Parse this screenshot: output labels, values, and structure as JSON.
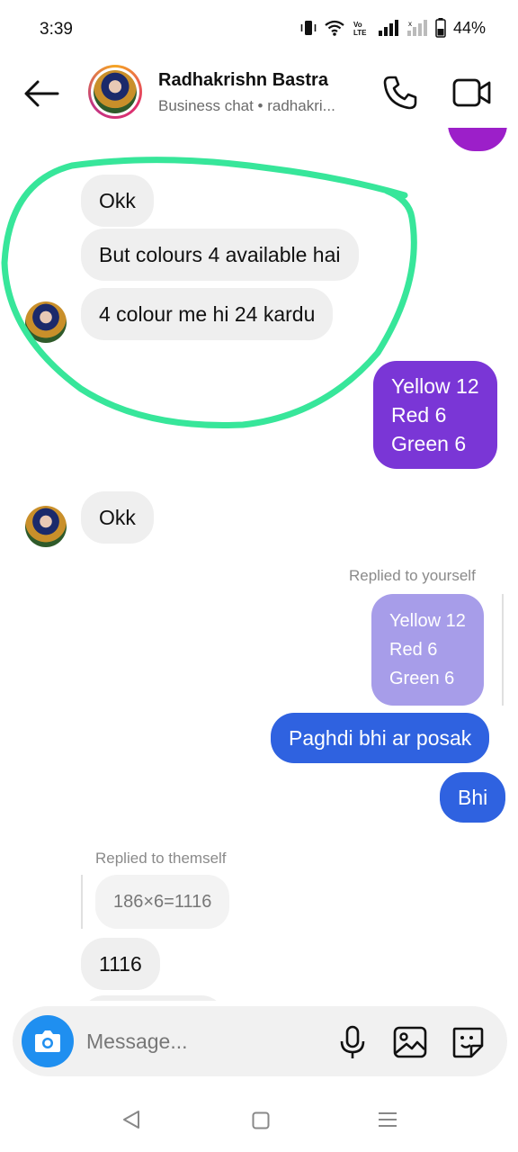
{
  "status_bar": {
    "time": "3:39",
    "battery": "44%"
  },
  "header": {
    "contact_name": "Radhakrishn Bastra",
    "subtitle": "Business chat • radhakri..."
  },
  "messages": {
    "in_1": "Okk",
    "in_2": "But colours 4 available hai",
    "in_3": "4 colour me hi 24 kardu",
    "out_1": "Yellow 12\nRed 6\nGreen 6",
    "in_4": "Okk",
    "reply_label_out": "Replied to yourself",
    "quoted_out": "Yellow 12\nRed 6\nGreen 6",
    "out_2": "Paghdi bhi ar posak",
    "out_3": "Bhi",
    "reply_label_in": "Replied to themself",
    "quoted_in": "186×6=1116",
    "in_5": "1116"
  },
  "composer": {
    "placeholder": "Message..."
  },
  "colors": {
    "outgoing_purple": "#7a36d6",
    "outgoing_blue": "#2f62e0",
    "incoming": "#efefef",
    "highlight_annotation": "#37e69a",
    "camera": "#1f8ff0"
  },
  "icons": {
    "header": [
      "back-arrow-icon",
      "phone-icon",
      "video-icon"
    ],
    "composer": [
      "camera-icon",
      "mic-icon",
      "gallery-icon",
      "sticker-icon"
    ],
    "nav": [
      "nav-back-icon",
      "nav-home-icon",
      "nav-menu-icon"
    ]
  }
}
